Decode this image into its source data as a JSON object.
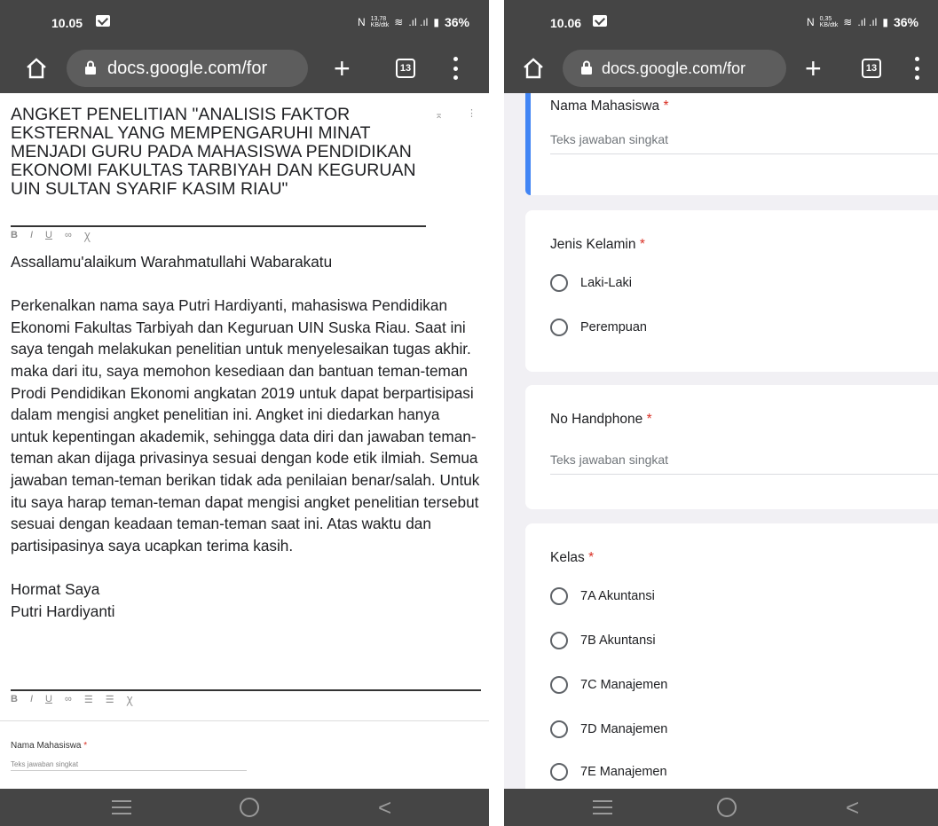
{
  "left_screen": {
    "status": {
      "time": "10.05",
      "speed": "13,78\nKB/dtk",
      "battery": "36%"
    },
    "browser": {
      "url": "docs.google.com/for",
      "tab_count": "13"
    },
    "form": {
      "title": "ANGKET PENELITIAN \"ANALISIS FAKTOR EKSTERNAL YANG MEMPENGARUHI MINAT MENJADI GURU PADA MAHASISWA PENDIDIKAN EKONOMI FAKULTAS TARBIYAH DAN KEGURUAN UIN SULTAN SYARIF KASIM RIAU\"",
      "title_toolbar": [
        "B",
        "I",
        "U",
        "⊝",
        "⨯"
      ],
      "greeting": "Assallamu'alaikum Warahmatullahi Wabarakatu",
      "body": "Perkenalkan nama saya Putri Hardiyanti, mahasiswa Pendidikan Ekonomi Fakultas Tarbiyah dan Keguruan UIN Suska Riau. Saat ini saya tengah melakukan penelitian untuk menyelesaikan tugas akhir. maka dari itu, saya memohon kesediaan dan bantuan teman-teman Prodi Pendidikan Ekonomi angkatan 2019 untuk dapat berpartisipasi dalam mengisi angket penelitian ini. Angket ini diedarkan hanya untuk kepentingan akademik, sehingga data diri dan jawaban teman-teman akan dijaga privasinya sesuai dengan kode etik ilmiah. Semua jawaban teman-teman berikan tidak ada penilaian benar/salah. Untuk itu saya harap teman-teman dapat mengisi angket penelitian tersebut sesuai dengan keadaan teman-teman saat ini. Atas waktu dan partisipasinya saya ucapkan terima kasih.",
      "closing": "Hormat Saya",
      "signature": "Putri Hardiyanti",
      "desc_toolbar": [
        "B",
        "I",
        "U",
        "⊝",
        "☰",
        "☰",
        "⨯"
      ],
      "question_label": "Nama Mahasiswa",
      "question_placeholder": "Teks jawaban singkat"
    }
  },
  "right_screen": {
    "status": {
      "time": "10.06",
      "speed": "0,35\nKB/dtk",
      "battery": "36%"
    },
    "browser": {
      "url": "docs.google.com/for",
      "tab_count": "13"
    },
    "questions": [
      {
        "label": "Nama Mahasiswa",
        "placeholder": "Teks jawaban singkat"
      },
      {
        "label": "Jenis Kelamin",
        "options": [
          "Laki-Laki",
          "Perempuan"
        ]
      },
      {
        "label": "No Handphone",
        "placeholder": "Teks jawaban singkat"
      },
      {
        "label": "Kelas",
        "options": [
          "7A Akuntansi",
          "7B Akuntansi",
          "7C Manajemen",
          "7D Manajemen",
          "7E Manajemen"
        ]
      }
    ],
    "required_mark": "*"
  },
  "colors": {
    "chrome_bar": "#454545",
    "url_pill": "#5d5d5d",
    "accent": "#4285f4",
    "required": "#d93025",
    "form_bg": "#f1f0f4"
  }
}
